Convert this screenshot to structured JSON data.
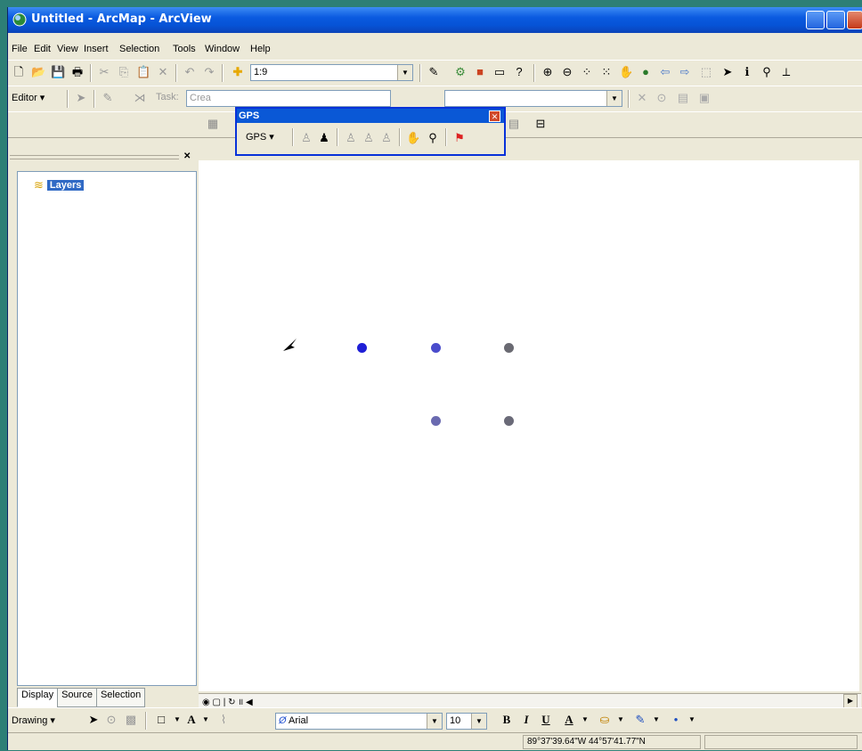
{
  "window": {
    "title": "Untitled - ArcMap - ArcView"
  },
  "menu": [
    "File",
    "Edit",
    "View",
    "Insert",
    "Selection",
    "Tools",
    "Window",
    "Help"
  ],
  "standard_toolbar": {
    "scale_value": "1:9"
  },
  "editor_toolbar": {
    "editor_label": "Editor",
    "task_label": "Task:",
    "task_value": "Crea"
  },
  "gps_window": {
    "title": "GPS",
    "menu_label": "GPS"
  },
  "toc": {
    "root_label": "Layers"
  },
  "tabs": [
    "Display",
    "Source",
    "Selection"
  ],
  "drawing_toolbar": {
    "drawing_label": "Drawing",
    "font_name": "Arial",
    "font_size": "10",
    "bold": "B",
    "italic": "I",
    "underline": "U",
    "font_color_glyph": "A"
  },
  "status": {
    "coordinates": "89°37'39.64\"W  44°57'41.77\"N"
  },
  "map_points": {
    "description_colors": [
      "#1f1fd6",
      "#5458b8",
      "#6a6a72"
    ],
    "cursor_icon": "arrow-pointer-icon"
  }
}
